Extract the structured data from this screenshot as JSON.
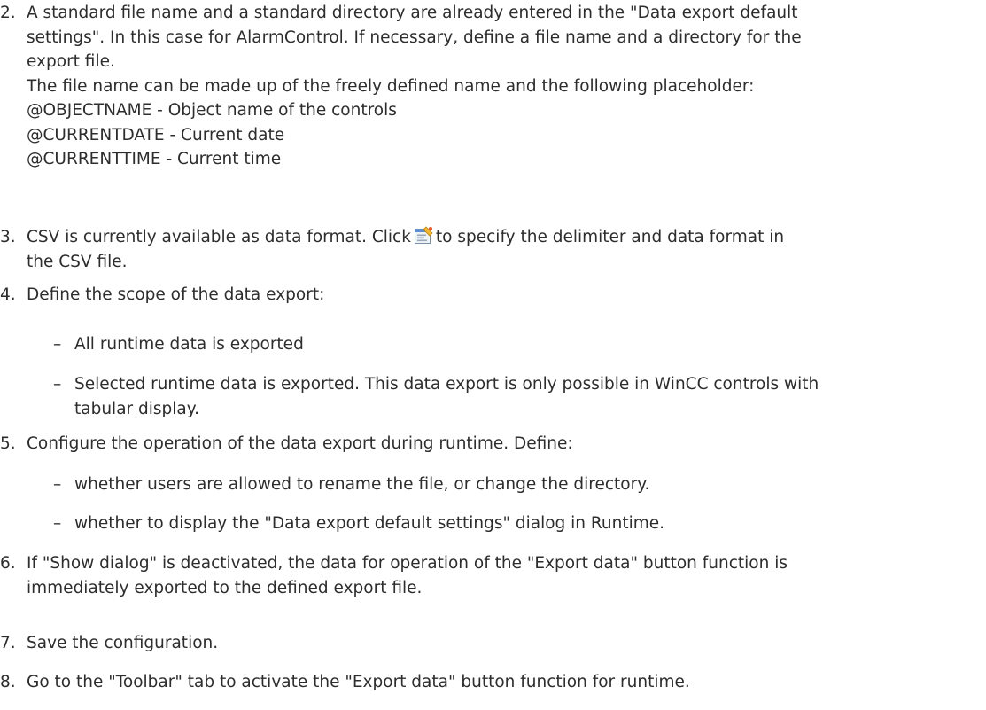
{
  "steps": {
    "s2": {
      "number": "2.",
      "lines": [
        "A standard file name and a standard directory are already entered in the \"Data export default",
        "settings\". In this case for AlarmControl. If necessary, define a file name and a directory for the",
        "export file.",
        "The file name can be made up of the freely defined name and the following placeholder:",
        "@OBJECTNAME - Object name of the controls",
        "@CURRENTDATE - Current date",
        "@CURRENTTIME - Current time"
      ]
    },
    "s3": {
      "number": "3.",
      "line1_before_icon": "CSV is currently available as data format. Click",
      "line1_after_icon": "to specify the delimiter and data format in",
      "line2": "the CSV file.",
      "icon": "settings-dialog-icon"
    },
    "s4": {
      "number": "4.",
      "text": "Define the scope of the data export:",
      "dash": "–",
      "sub1": "All runtime data is exported",
      "sub2_line1": "Selected runtime data is exported. This data export is only possible in WinCC controls with",
      "sub2_line2": "tabular display."
    },
    "s5": {
      "number": "5.",
      "text": "Configure the operation of the data export during runtime. Define:",
      "dash": "–",
      "sub1": "whether users are allowed to rename the file, or change the directory.",
      "sub2": "whether to display the \"Data export default settings\" dialog in Runtime."
    },
    "s6": {
      "number": "6.",
      "line1": "If \"Show dialog\" is deactivated, the data for operation of the \"Export data\" button function is",
      "line2": "immediately exported to the defined export file."
    },
    "s7": {
      "number": "7.",
      "text": "Save the configuration."
    },
    "s8": {
      "number": "8.",
      "text": "Go to the \"Toolbar\" tab to activate the \"Export data\" button function for runtime."
    }
  },
  "colors": {
    "text": "#2d2d2d",
    "icon_frame": "#7a8fa8",
    "icon_accent": "#f2b632"
  }
}
